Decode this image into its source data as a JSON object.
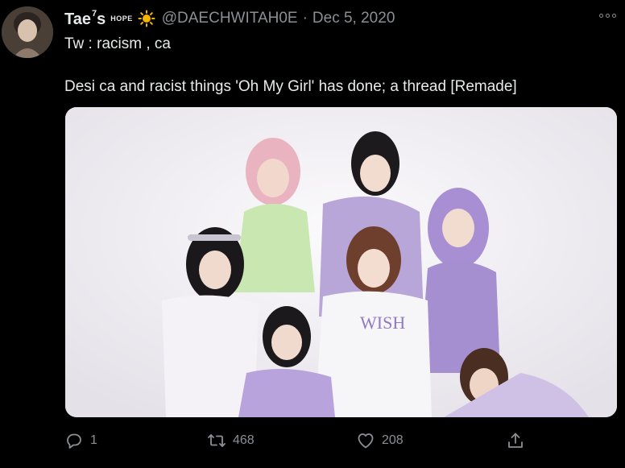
{
  "tweet": {
    "display_name": "Tae",
    "display_name_sup": "7",
    "display_name_suffix": "s",
    "display_tag": "HOPE",
    "handle": "@DAECHWITAH0E",
    "separator": "·",
    "date": "Dec 5, 2020",
    "line1": "Tw : racism , ca",
    "line2": "Desi ca and racist things 'Oh My Girl' has done; a thread [Remade]",
    "icons": {
      "avatar": "avatar",
      "sun": "sun-emoji-icon",
      "more": "more-options-icon"
    }
  },
  "media": {
    "description_icon": "group-photo"
  },
  "actions": {
    "reply_count": "1",
    "retweet_count": "468",
    "like_count": "208",
    "icons": [
      "reply-icon",
      "retweet-icon",
      "like-icon",
      "share-icon"
    ]
  },
  "colors": {
    "background": "#000000",
    "primary_text": "#e7e9ea",
    "secondary_text": "#8b8f93",
    "accent_lavender": "#b39ddb"
  }
}
